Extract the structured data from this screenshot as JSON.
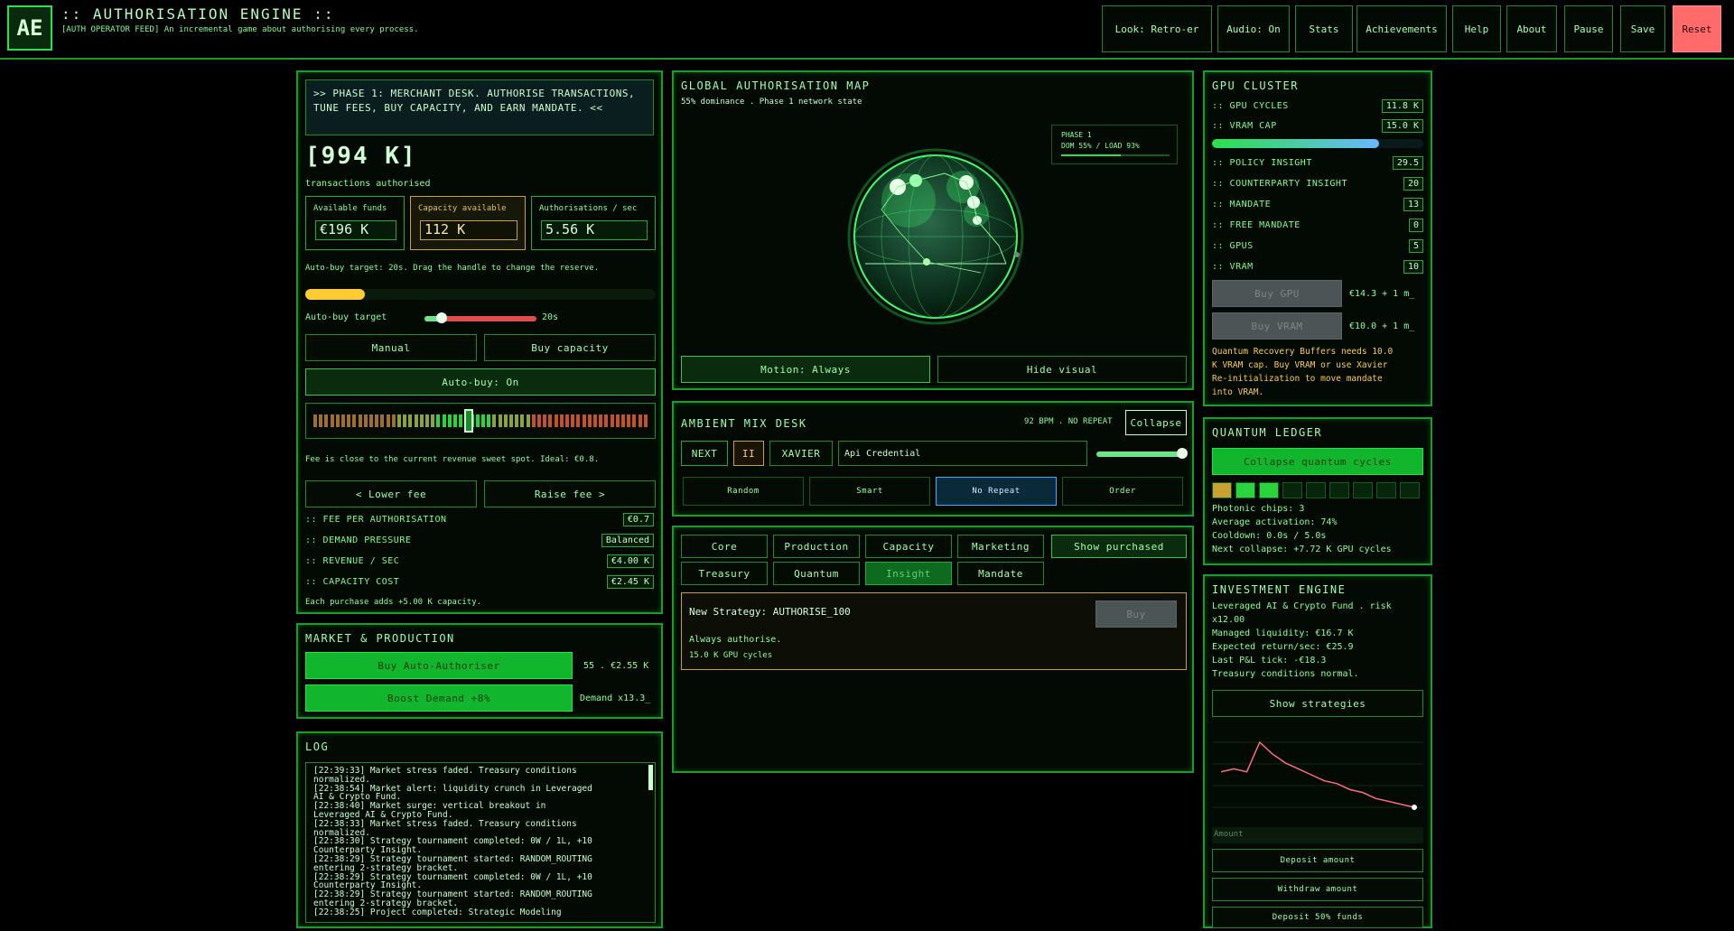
{
  "header": {
    "logo": "AE",
    "title": ":: AUTHORISATION ENGINE ::",
    "subtitle": "[AUTH OPERATOR FEED] An incremental game about authorising every process.",
    "buttons": {
      "look": "Look: Retro-er",
      "audio": "Audio: On",
      "stats": "Stats",
      "achievements": "Achievements",
      "help": "Help",
      "about": "About",
      "pause": "Pause",
      "save": "Save",
      "reset": "Reset"
    }
  },
  "colors": {
    "accent": "#2ae04a",
    "reset": "#ff6b6b",
    "bg": "#000000",
    "panel_border": "#1d9a2c"
  },
  "desk": {
    "phase_text": ">> PHASE 1: MERCHANT DESK. AUTHORISE TRANSACTIONS, TUNE FEES, BUY CAPACITY, AND EARN MANDATE. <<",
    "counter": "[994 K]",
    "counter_label": "transactions authorised",
    "boxes": [
      {
        "label": "Available funds",
        "value": "€196 K"
      },
      {
        "label": "Capacity available",
        "value": "112 K"
      },
      {
        "label": "Authorisations / sec",
        "value": "5.56 K"
      }
    ],
    "autobuy_text": "Auto-buy target: 20s. Drag the handle to change the reserve.",
    "progress_fraction": 0.17,
    "slider_label": "Auto-buy target",
    "slider_value": "20s",
    "slider_fraction": 0.15,
    "manual": "Manual",
    "buy_capacity": "Buy capacity",
    "autobuy": "Auto-buy: On",
    "fee_meter_fraction": 0.45,
    "fee_note": "Fee is close to the current revenue sweet spot. Ideal: €0.8.",
    "lower_fee": "< Lower fee",
    "raise_fee": "Raise fee >",
    "stats": [
      {
        "label": ":: FEE PER AUTHORISATION",
        "value": "€0.7"
      },
      {
        "label": ":: DEMAND PRESSURE",
        "value": "Balanced"
      },
      {
        "label": ":: REVENUE / SEC",
        "value": "€4.00 K"
      },
      {
        "label": ":: CAPACITY COST",
        "value": "€2.45 K"
      }
    ],
    "footnote": "Each purchase adds +5.00 K capacity."
  },
  "market": {
    "title": "MARKET & PRODUCTION",
    "buy_auto": "Buy Auto-Authoriser",
    "buy_auto_info": "55 . €2.55 K",
    "boost": "Boost Demand +8%",
    "boost_info": "Demand x13.3_"
  },
  "log": {
    "title": "LOG",
    "lines": [
      "[22:39:33] Market stress faded. Treasury conditions",
      "normalized.",
      "[22:38:54] Market alert: liquidity crunch in Leveraged",
      "AI & Crypto Fund.",
      "[22:38:40] Market surge: vertical breakout in",
      "Leveraged AI & Crypto Fund.",
      "[22:38:33] Market stress faded. Treasury conditions",
      "normalized.",
      "[22:38:30] Strategy tournament completed: 0W / 1L, +10",
      "Counterparty Insight.",
      "[22:38:29] Strategy tournament started: RANDOM_ROUTING",
      "entering 2-strategy bracket.",
      "[22:38:29] Strategy tournament completed: 0W / 1L, +10",
      "Counterparty Insight.",
      "[22:38:29] Strategy tournament started: RANDOM_ROUTING",
      "entering 2-strategy bracket.",
      "[22:38:25] Project completed: Strategic Modeling"
    ]
  },
  "map": {
    "title": "GLOBAL AUTHORISATION MAP",
    "subtitle": "55% dominance . Phase 1 network state",
    "legend_phase": "PHASE 1",
    "legend_stats": "DOM 55% / LOAD 93%",
    "motion": "Motion: Always",
    "hide": "Hide visual"
  },
  "mix": {
    "title": "AMBIENT MIX DESK",
    "bpm": "92 BPM . NO REPEAT",
    "collapse": "Collapse",
    "next": "NEXT",
    "pause": "II",
    "artist": "XAVIER",
    "track": "Api Credential",
    "volume_fraction": 0.95,
    "modes": [
      "Random",
      "Smart",
      "No Repeat",
      "Order"
    ]
  },
  "research": {
    "tabs": [
      "Core",
      "Production",
      "Capacity",
      "Marketing",
      "Show purchased",
      "Treasury",
      "Quantum",
      "Insight",
      "Mandate"
    ],
    "card_title": "New Strategy: AUTHORISE_100",
    "card_buy": "Buy",
    "card_desc": "Always authorise.",
    "card_cost": "15.0 K GPU cycles"
  },
  "gpu": {
    "title": "GPU CLUSTER",
    "stats": [
      {
        "label": ":: GPU CYCLES",
        "value": "11.8 K"
      },
      {
        "label": ":: VRAM CAP",
        "value": "15.0 K"
      },
      {
        "label": ":: POLICY INSIGHT",
        "value": "29.5"
      },
      {
        "label": ":: COUNTERPARTY INSIGHT",
        "value": "20"
      },
      {
        "label": ":: MANDATE",
        "value": "13"
      },
      {
        "label": ":: FREE MANDATE",
        "value": "0"
      },
      {
        "label": ":: GPUS",
        "value": "5"
      },
      {
        "label": ":: VRAM",
        "value": "10"
      }
    ],
    "vram_fraction": 0.79,
    "buy_gpu": "Buy GPU",
    "buy_gpu_cost": "€14.3 + 1 m_",
    "buy_vram": "Buy VRAM",
    "buy_vram_cost": "€10.0 + 1 m_",
    "note": [
      "Quantum Recovery Buffers needs 10.0",
      "K VRAM cap. Buy VRAM or use Xavier",
      "Re-initialization to move mandate",
      "into VRAM."
    ]
  },
  "quantum": {
    "title": "QUANTUM LEDGER",
    "collapse": "Collapse quantum cycles",
    "chips": [
      "#c9a032",
      "#2ad43c",
      "#2ad43c",
      "#06250b",
      "#06250b",
      "#06250b",
      "#06250b",
      "#06250b",
      "#06250b"
    ],
    "lines": [
      "Photonic chips: 3",
      "Average activation: 74%",
      "Cooldown: 0.0s / 5.0s",
      "Next collapse: +7.72 K GPU cycles"
    ]
  },
  "invest": {
    "title": "INVESTMENT ENGINE",
    "lines": [
      "Leveraged AI & Crypto Fund . risk",
      "x12.00",
      "Managed liquidity: €16.7 K",
      "Expected return/sec: €25.9",
      "Last P&L tick: -€18.3",
      "Treasury conditions normal."
    ],
    "show": "Show strategies",
    "chart_values": [
      60,
      61,
      60,
      70,
      66,
      63,
      61,
      59,
      57,
      56,
      54,
      53,
      51,
      50,
      49,
      48
    ],
    "amount_placeholder": "Amount",
    "deposit": "Deposit amount",
    "withdraw": "Withdraw amount",
    "deposit50": "Deposit 50% funds"
  }
}
